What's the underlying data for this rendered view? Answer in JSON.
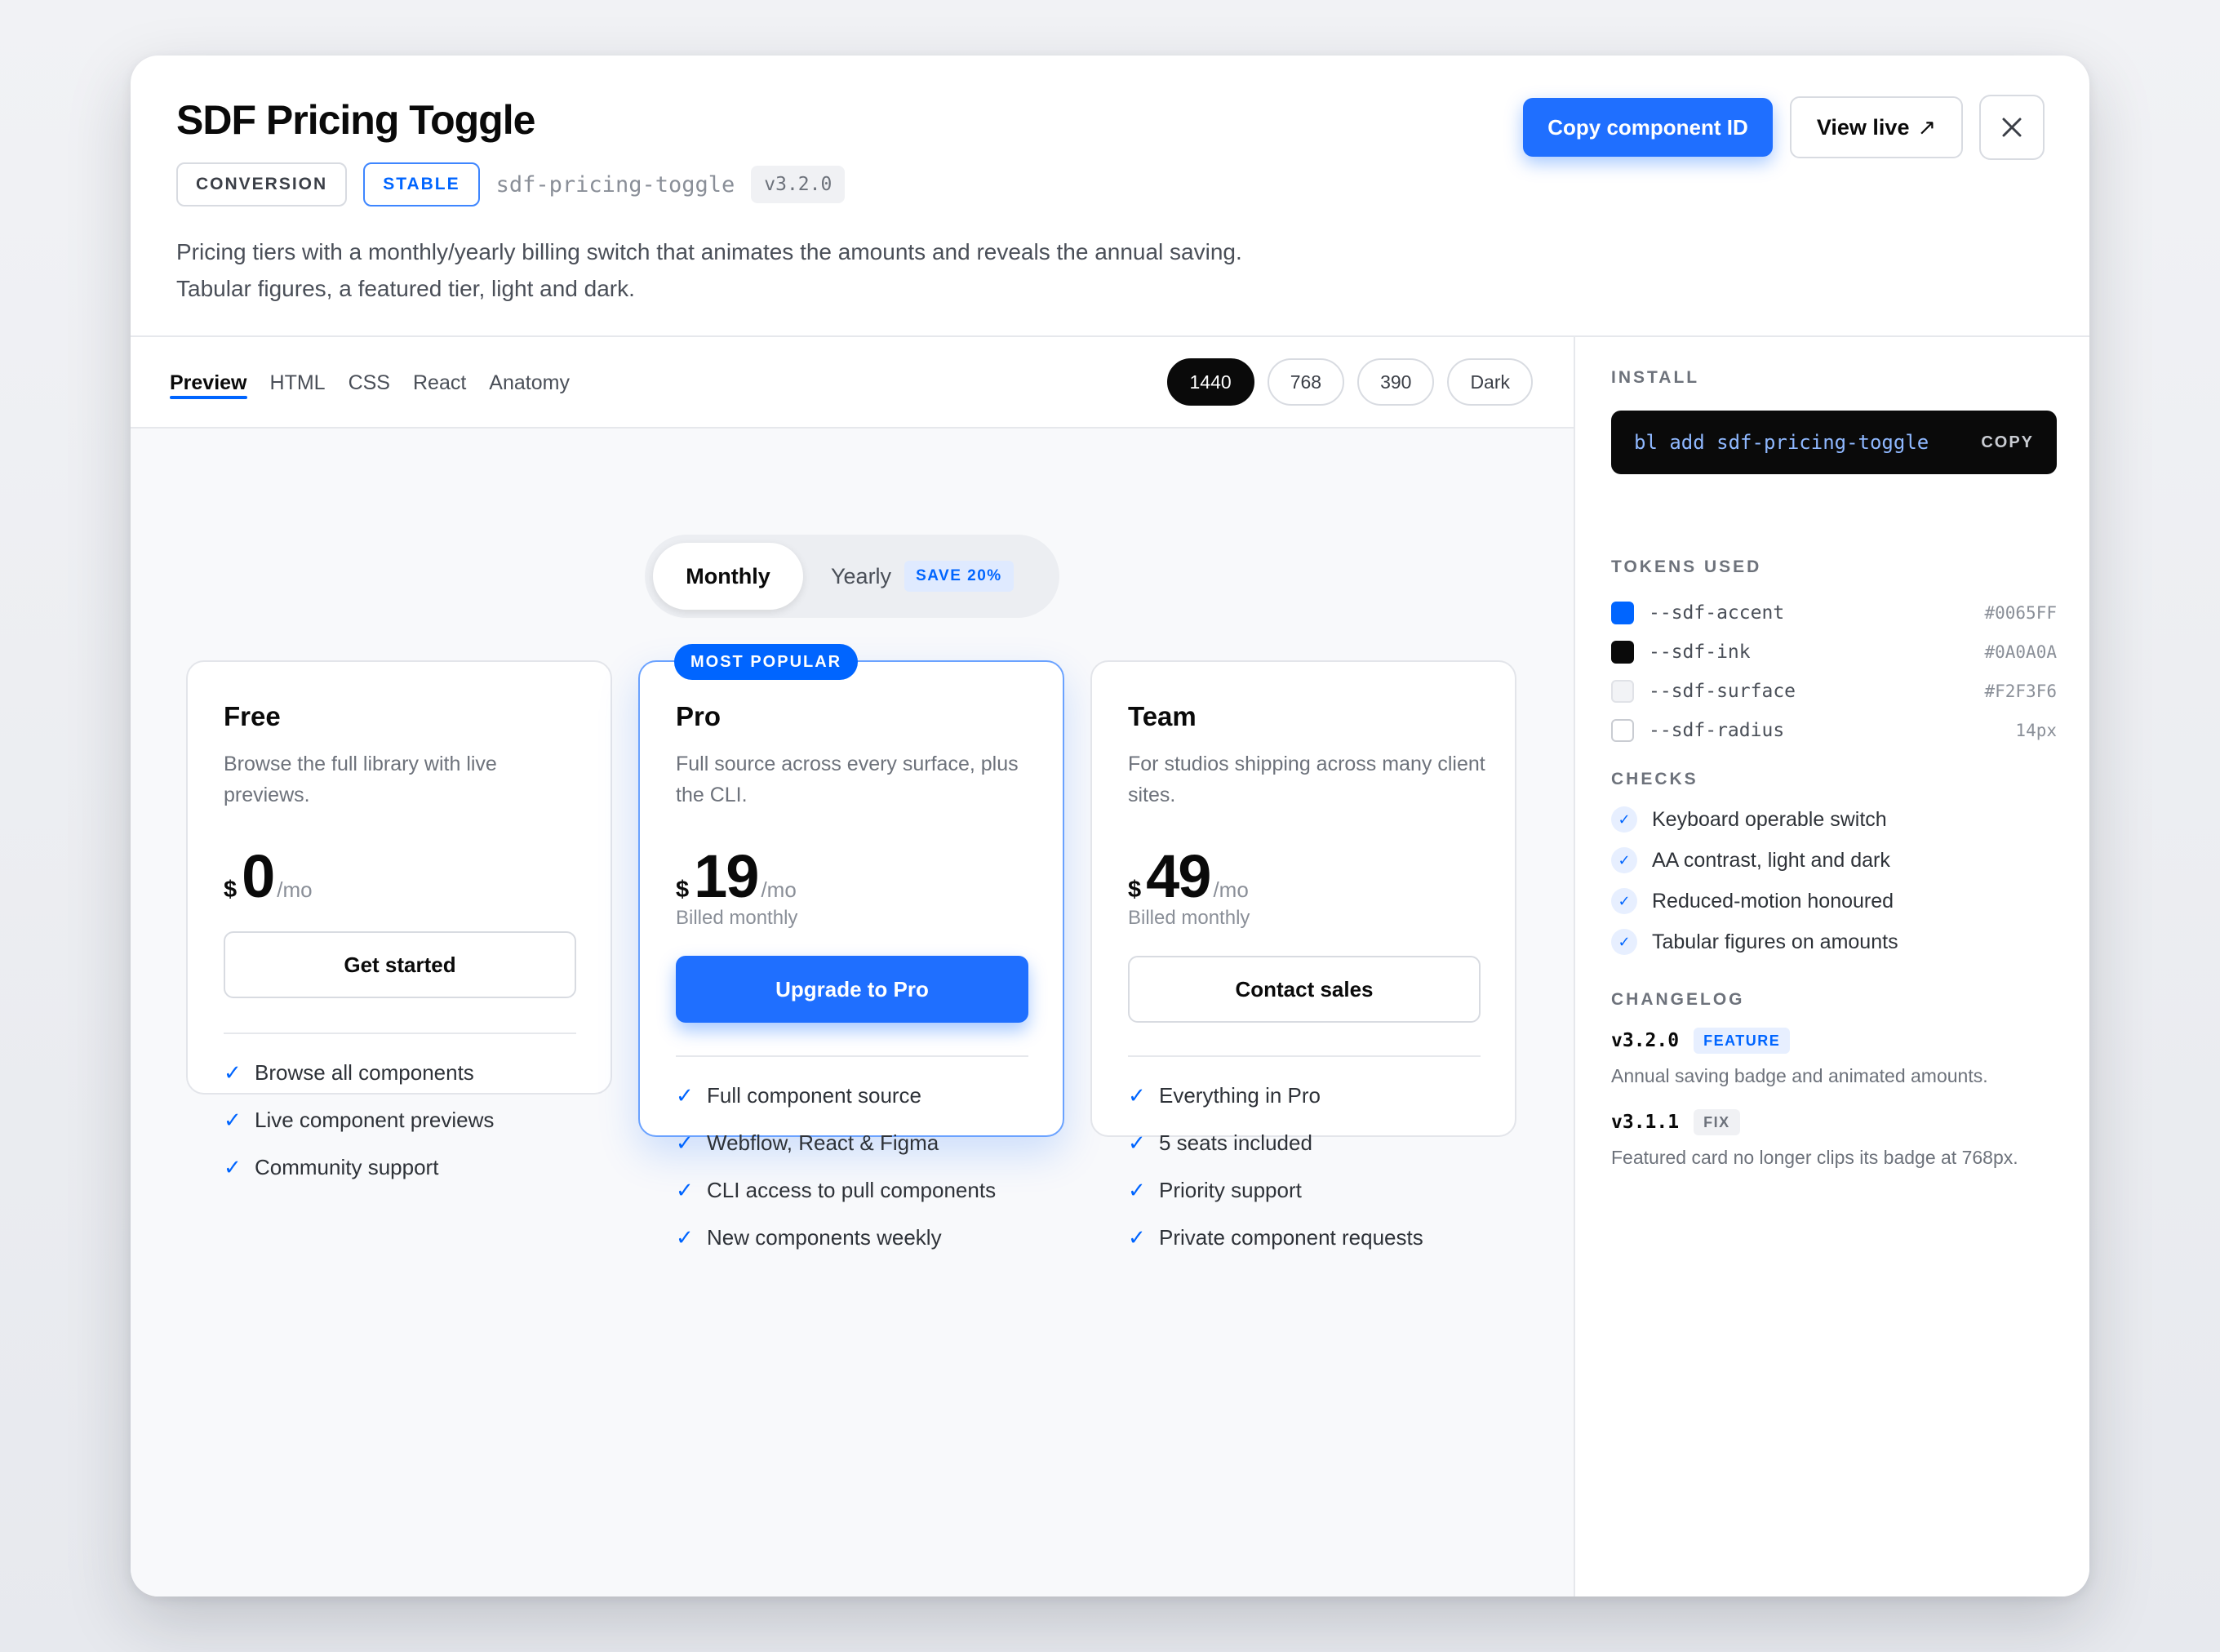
{
  "header": {
    "title": "SDF Pricing Toggle",
    "chips": {
      "category": "CONVERSION",
      "status": "STABLE",
      "slug": "sdf-pricing-toggle",
      "version": "v3.2.0"
    },
    "description_line1": "Pricing tiers with a monthly/yearly billing switch that animates the amounts and reveals the annual saving.",
    "description_line2": "Tabular figures, a featured tier, light and dark.",
    "copy_button": "Copy component ID",
    "view_live_button": "View live",
    "view_live_icon": "↗",
    "close_icon": "close-icon"
  },
  "tabs": [
    "Preview",
    "HTML",
    "CSS",
    "React",
    "Anatomy"
  ],
  "active_tab": "Preview",
  "viewports": [
    "1440",
    "768",
    "390",
    "Dark"
  ],
  "active_viewport": "1440",
  "billing_toggle": {
    "monthly": "Monthly",
    "yearly": "Yearly",
    "save_badge": "SAVE 20%",
    "selected": "Monthly"
  },
  "plans": [
    {
      "name": "Free",
      "description": "Browse the full library with live previews.",
      "currency": "$",
      "amount": "0",
      "period": "/mo",
      "billed": "",
      "cta": "Get started",
      "features": [
        "Browse all components",
        "Live component previews",
        "Community support"
      ]
    },
    {
      "name": "Pro",
      "badge": "MOST POPULAR",
      "description": "Full source across every surface, plus the CLI.",
      "currency": "$",
      "amount": "19",
      "period": "/mo",
      "billed": "Billed monthly",
      "cta": "Upgrade to Pro",
      "features": [
        "Full component source",
        "Webflow, React & Figma",
        "CLI access to pull components",
        "New components weekly"
      ]
    },
    {
      "name": "Team",
      "description": "For studios shipping across many client sites.",
      "currency": "$",
      "amount": "49",
      "period": "/mo",
      "billed": "Billed monthly",
      "cta": "Contact sales",
      "features": [
        "Everything in Pro",
        "5 seats included",
        "Priority support",
        "Private component requests"
      ]
    }
  ],
  "sidebar": {
    "install_label": "INSTALL",
    "install_command": "bl add sdf-pricing-toggle",
    "install_copy": "COPY",
    "tokens_label": "TOKENS USED",
    "tokens": [
      {
        "name": "--sdf-accent",
        "value": "#0065FF",
        "swatch": "#0065FF"
      },
      {
        "name": "--sdf-ink",
        "value": "#0A0A0A",
        "swatch": "#0A0A0A"
      },
      {
        "name": "--sdf-surface",
        "value": "#F2F3F6",
        "swatch": "#F2F3F6"
      },
      {
        "name": "--sdf-radius",
        "value": "14px",
        "swatch": "#FFFFFF"
      }
    ],
    "checks_label": "CHECKS",
    "checks": [
      "Keyboard operable switch",
      "AA contrast, light and dark",
      "Reduced-motion honoured",
      "Tabular figures on amounts"
    ],
    "changelog_label": "CHANGELOG",
    "changelog": [
      {
        "version": "v3.2.0",
        "tag": "FEATURE",
        "text": "Annual saving badge and animated amounts."
      },
      {
        "version": "v3.1.1",
        "tag": "FIX",
        "text": "Featured card no longer clips its badge at 768px."
      }
    ]
  },
  "colors": {
    "accent": "#0065FF",
    "ink": "#0A0A0A",
    "surface": "#F2F3F6"
  }
}
